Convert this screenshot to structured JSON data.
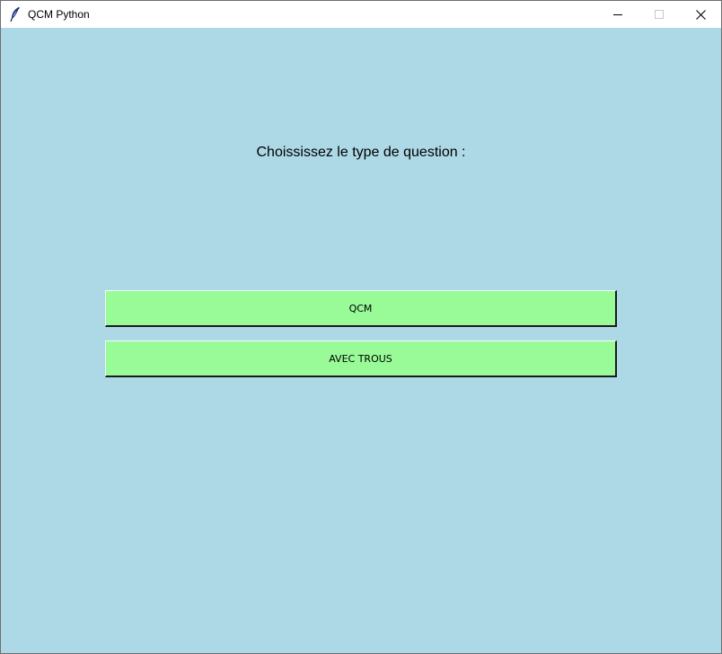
{
  "window": {
    "title": "QCM Python",
    "icon": "feather-icon"
  },
  "title_buttons": {
    "minimize": "minimize-icon",
    "maximize": "maximize-icon",
    "close": "close-icon"
  },
  "main": {
    "prompt": "Choississez le type de question :",
    "buttons": [
      {
        "label": "QCM"
      },
      {
        "label": "AVEC TROUS"
      }
    ]
  },
  "colors": {
    "background": "#add8e6",
    "button": "#98fb98",
    "titlebar": "#ffffff"
  }
}
